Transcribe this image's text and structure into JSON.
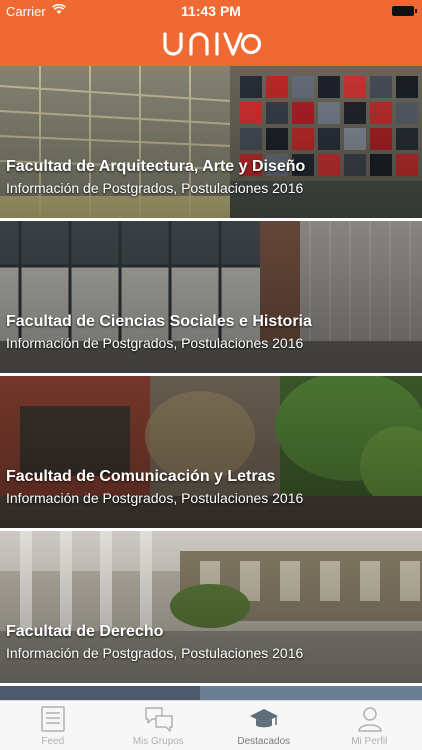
{
  "status_bar": {
    "carrier": "Carrier",
    "time": "11:43 PM"
  },
  "nav_bar": {
    "logo_text": "UNIVO",
    "background_color": "#ef6a33"
  },
  "cards": [
    {
      "title": "Facultad de Arquitectura, Arte y Diseño",
      "subtitle": "Información de Postgrados, Postulaciones 2016"
    },
    {
      "title": "Facultad de Ciencias Sociales e Historia",
      "subtitle": "Información de Postgrados, Postulaciones 2016"
    },
    {
      "title": "Facultad de Comunicación y Letras",
      "subtitle": "Información de Postgrados, Postulaciones 2016"
    },
    {
      "title": "Facultad de Derecho",
      "subtitle": "Información de Postgrados, Postulaciones 2016"
    }
  ],
  "tab_bar": {
    "tabs": [
      {
        "label": "Feed",
        "icon": "newspaper-icon"
      },
      {
        "label": "Mis Grupos",
        "icon": "chat-bubbles-icon"
      },
      {
        "label": "Destacados",
        "icon": "graduation-cap-icon",
        "active": true
      },
      {
        "label": "Mi Perfil",
        "icon": "person-icon"
      }
    ]
  }
}
